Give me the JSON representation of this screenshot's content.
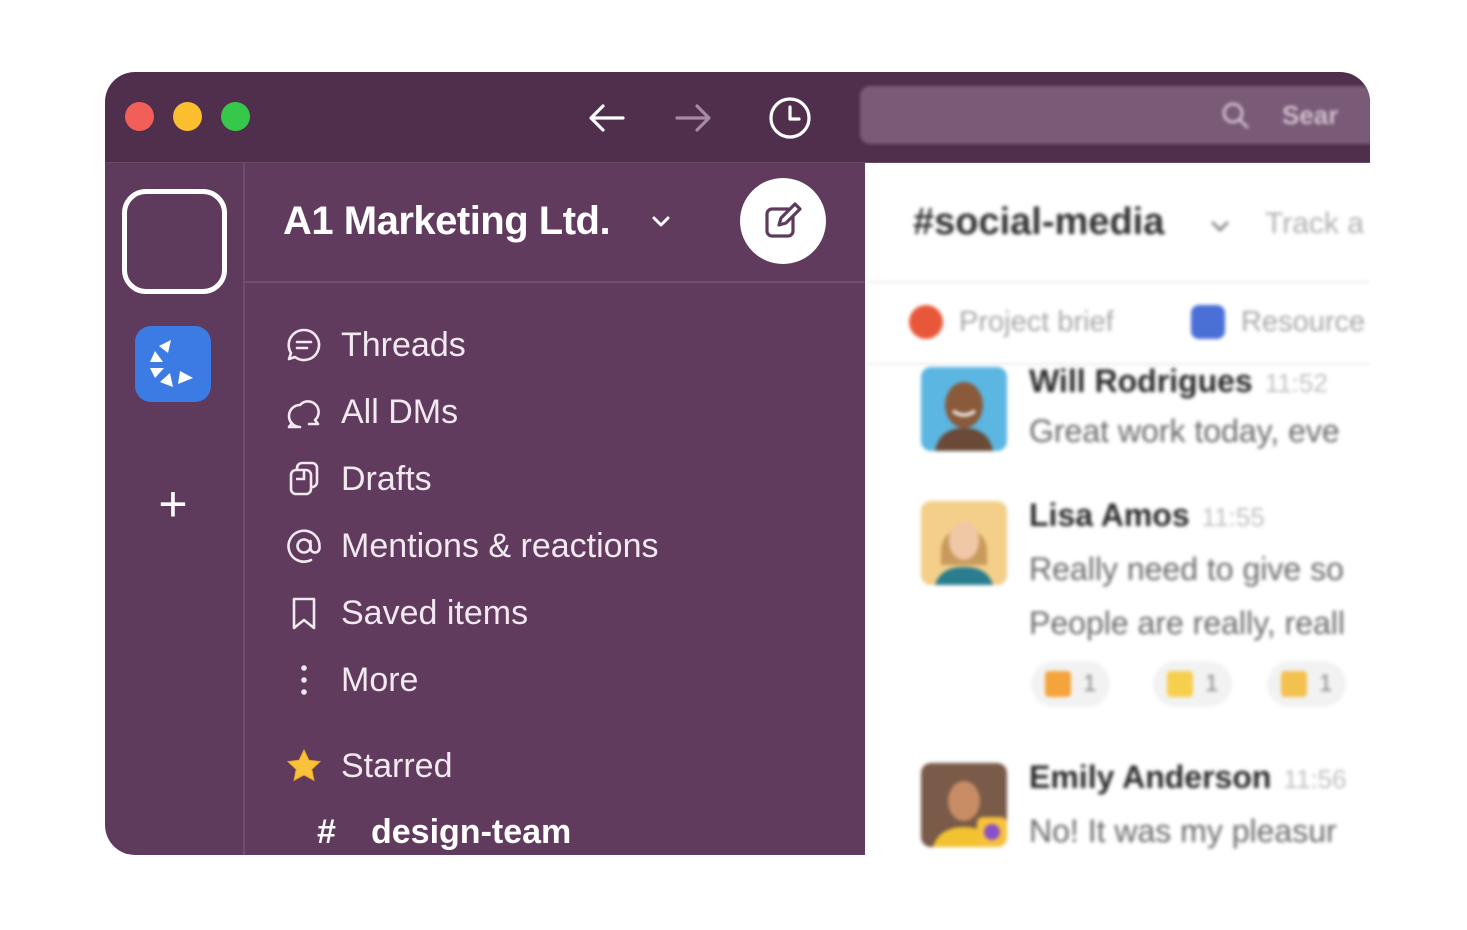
{
  "titlebar": {
    "back_icon": "arrow-left-icon",
    "forward_icon": "arrow-right-icon",
    "history_icon": "clock-icon",
    "search_placeholder": "Sear"
  },
  "rail": {
    "add_label": "+"
  },
  "sidebar": {
    "workspace_name": "A1 Marketing Ltd.",
    "items": [
      {
        "label": "Threads",
        "icon": "threads-icon"
      },
      {
        "label": "All DMs",
        "icon": "dms-icon"
      },
      {
        "label": "Drafts",
        "icon": "drafts-icon"
      },
      {
        "label": "Mentions & reactions",
        "icon": "mention-icon"
      },
      {
        "label": "Saved items",
        "icon": "bookmark-icon"
      },
      {
        "label": "More",
        "icon": "more-vertical-icon"
      }
    ],
    "starred_label": "Starred",
    "channels": [
      {
        "hash": "#",
        "name": "design-team"
      }
    ]
  },
  "main": {
    "channel_name": "#social-media",
    "topic": "Track a",
    "bookmarks": [
      {
        "label": "Project brief",
        "color": "#e8573a"
      },
      {
        "label": "Resource",
        "color": "#4a6fd6"
      }
    ],
    "messages": [
      {
        "author": "Will Rodrigues",
        "time": "11:52",
        "lines": [
          "Great work today, eve"
        ]
      },
      {
        "author": "Lisa Amos",
        "time": "11:55",
        "lines": [
          "Really need to give so",
          "People are really, reall"
        ]
      },
      {
        "author": "Emily Anderson",
        "time": "11:56",
        "lines": [
          "No! It was my pleasur"
        ]
      }
    ],
    "reactions": [
      {
        "count": "1",
        "color": "#f4a43a"
      },
      {
        "count": "1",
        "color": "#f6d04d"
      },
      {
        "count": "1",
        "color": "#f2c14e"
      }
    ]
  },
  "colors": {
    "titlebar": "#4f2f4c",
    "sidebar": "#613b5e",
    "rail": "#5e3a5c",
    "accent_blue": "#3d7be4"
  }
}
